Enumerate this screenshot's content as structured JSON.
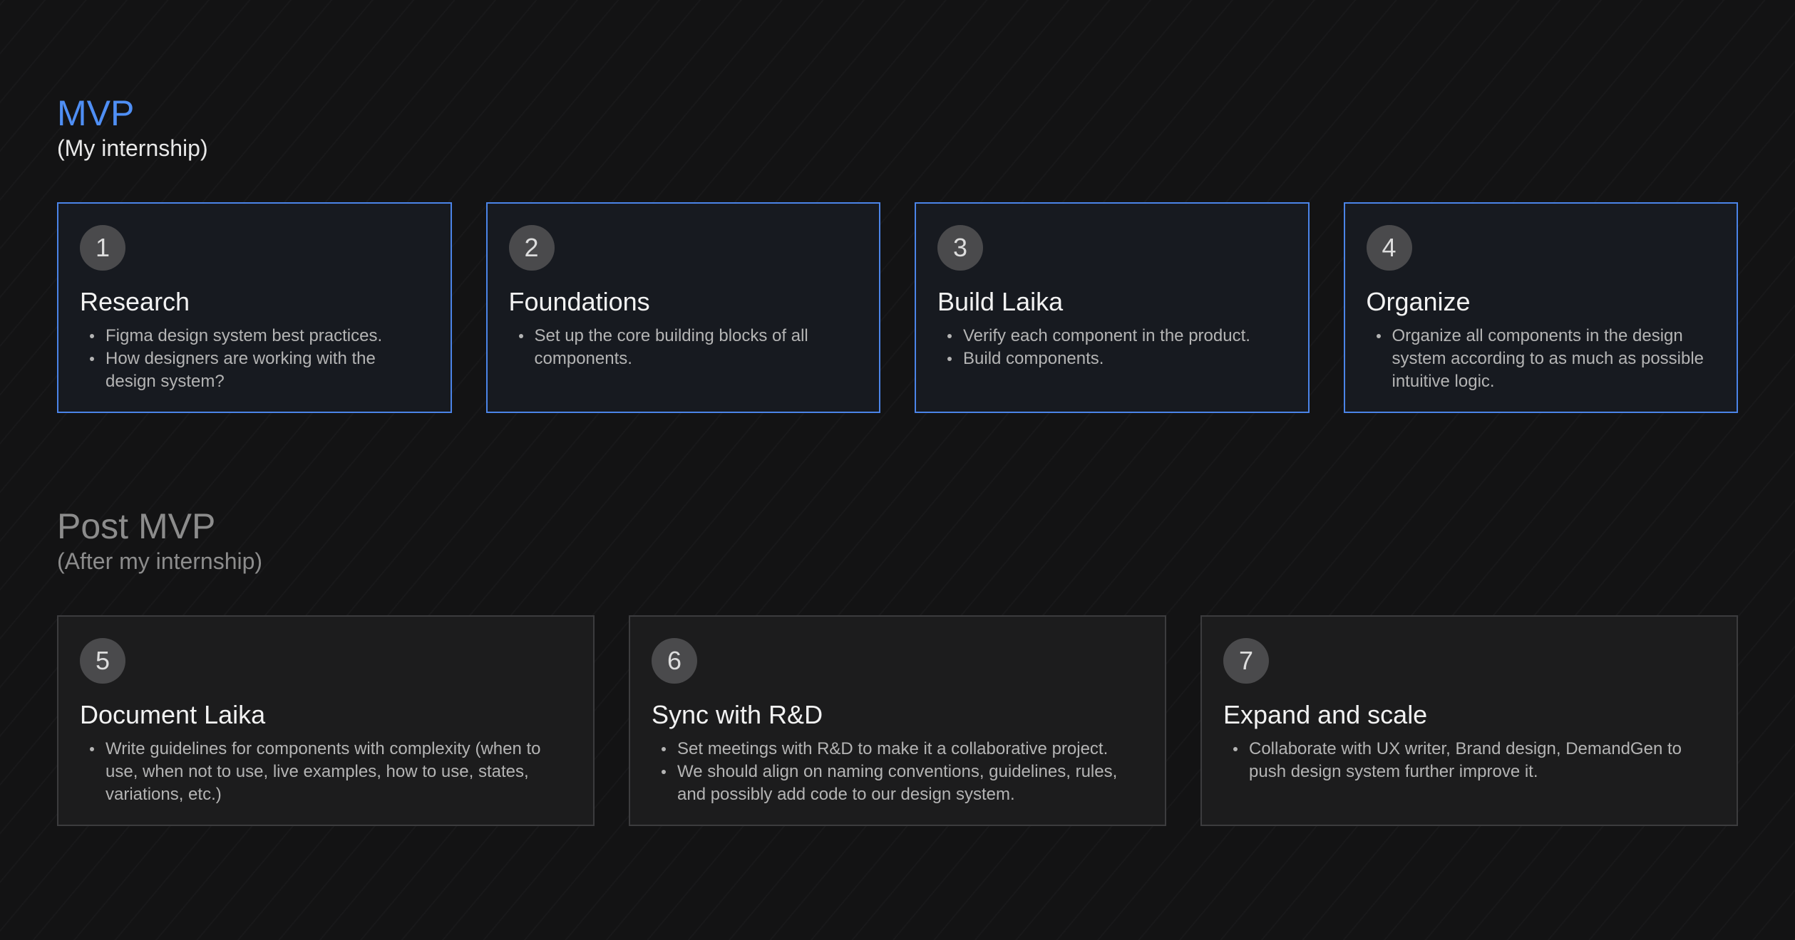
{
  "sections": [
    {
      "title": "MVP",
      "subtitle": "(My internship)",
      "cards": [
        {
          "number": "1",
          "title": "Research",
          "bullets": [
            "Figma design system best practices.",
            "How designers are working with the design system?"
          ]
        },
        {
          "number": "2",
          "title": "Foundations",
          "bullets": [
            "Set up the core building blocks of all components."
          ]
        },
        {
          "number": "3",
          "title": "Build Laika",
          "bullets": [
            "Verify each component in the product.",
            "Build components."
          ]
        },
        {
          "number": "4",
          "title": "Organize",
          "bullets": [
            "Organize all components in the design system according to as much as possible intuitive logic."
          ]
        }
      ]
    },
    {
      "title": "Post MVP",
      "subtitle": "(After my internship)",
      "cards": [
        {
          "number": "5",
          "title": "Document Laika",
          "bullets": [
            "Write guidelines for components with complexity (when to use, when not to use, live examples, how to use, states, variations, etc.)"
          ]
        },
        {
          "number": "6",
          "title": "Sync with R&D",
          "bullets": [
            "Set meetings with R&D to make it a collaborative project.",
            "We should align on naming conventions, guidelines, rules, and possibly add code to our design system."
          ]
        },
        {
          "number": "7",
          "title": "Expand and scale",
          "bullets": [
            "Collaborate with UX writer, Brand design, DemandGen to push design system further improve it."
          ]
        }
      ]
    }
  ],
  "colors": {
    "mvp_accent": "#4f8ff5",
    "mvp_border": "#4b84e8",
    "post_muted": "#8c8c8c",
    "background": "#131314"
  }
}
